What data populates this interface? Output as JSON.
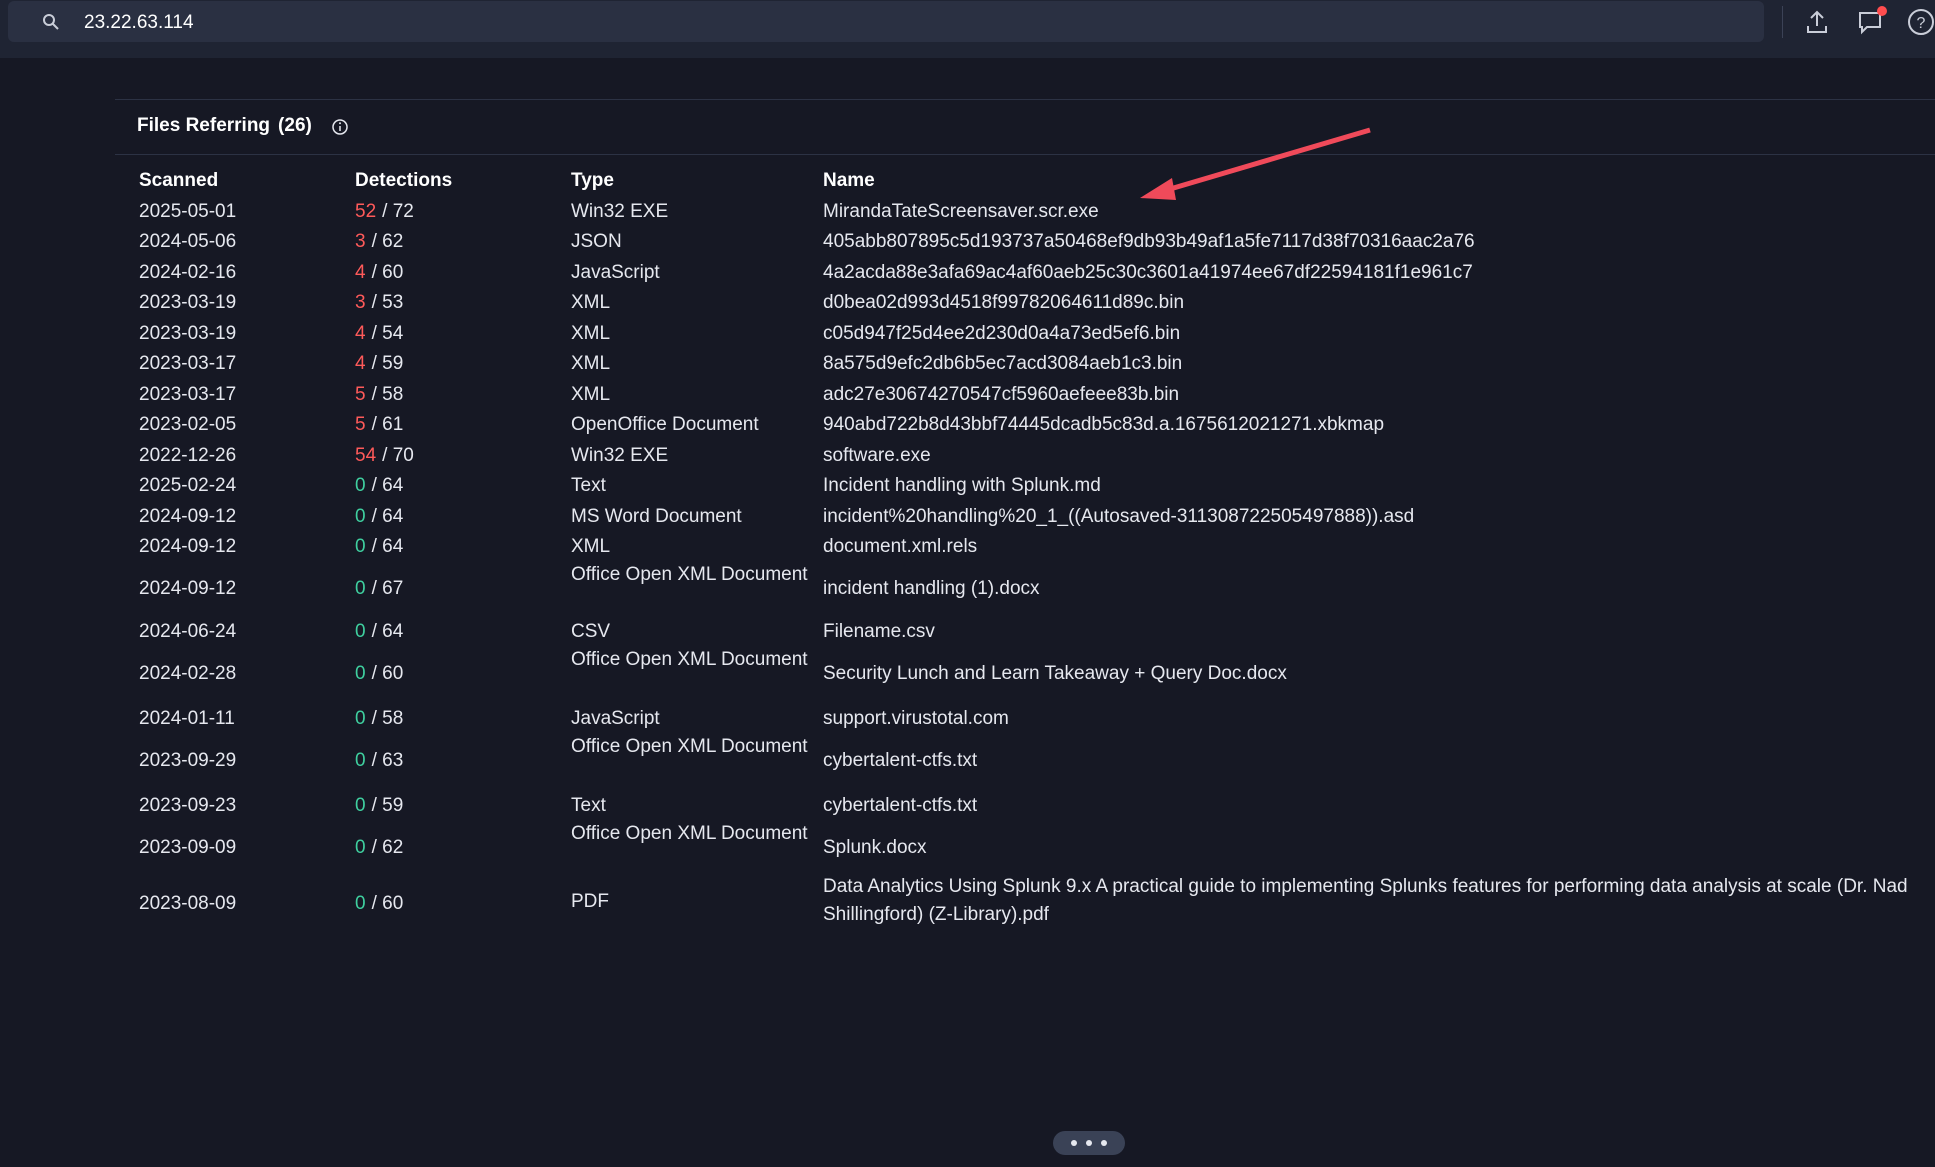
{
  "search": {
    "value": "23.22.63.114"
  },
  "toolbar": {
    "upload_icon": "upload-icon",
    "chat_icon": "chat-icon",
    "help_icon": "help-icon",
    "notification_color": "#ff4d4f"
  },
  "section": {
    "title": "Files Referring",
    "count": "(26)"
  },
  "table": {
    "headers": {
      "scanned": "Scanned",
      "detections": "Detections",
      "type": "Type",
      "name": "Name"
    },
    "rows": [
      {
        "scanned": "2025-05-01",
        "det": "52",
        "total": "/ 72",
        "type": "Win32 EXE",
        "name": "MirandaTateScreensaver.scr.exe"
      },
      {
        "scanned": "2024-05-06",
        "det": "3",
        "total": "/ 62",
        "type": "JSON",
        "name": "405abb807895c5d193737a50468ef9db93b49af1a5fe7117d38f70316aac2a76"
      },
      {
        "scanned": "2024-02-16",
        "det": "4",
        "total": "/ 60",
        "type": "JavaScript",
        "name": "4a2acda88e3afa69ac4af60aeb25c30c3601a41974ee67df22594181f1e961c7"
      },
      {
        "scanned": "2023-03-19",
        "det": "3",
        "total": "/ 53",
        "type": "XML",
        "name": "d0bea02d993d4518f99782064611d89c.bin"
      },
      {
        "scanned": "2023-03-19",
        "det": "4",
        "total": "/ 54",
        "type": "XML",
        "name": "c05d947f25d4ee2d230d0a4a73ed5ef6.bin"
      },
      {
        "scanned": "2023-03-17",
        "det": "4",
        "total": "/ 59",
        "type": "XML",
        "name": "8a575d9efc2db6b5ec7acd3084aeb1c3.bin"
      },
      {
        "scanned": "2023-03-17",
        "det": "5",
        "total": "/ 58",
        "type": "XML",
        "name": "adc27e30674270547cf5960aefeee83b.bin"
      },
      {
        "scanned": "2023-02-05",
        "det": "5",
        "total": "/ 61",
        "type": "OpenOffice Document",
        "name": "940abd722b8d43bbf74445dcadb5c83d.a.1675612021271.xbkmap"
      },
      {
        "scanned": "2022-12-26",
        "det": "54",
        "total": "/ 70",
        "type": "Win32 EXE",
        "name": "software.exe"
      },
      {
        "scanned": "2025-02-24",
        "det": "0",
        "total": "/ 64",
        "type": "Text",
        "name": "Incident handling with Splunk.md"
      },
      {
        "scanned": "2024-09-12",
        "det": "0",
        "total": "/ 64",
        "type": "MS Word Document",
        "name": "incident%20handling%20_1_((Autosaved-311308722505497888)).asd"
      },
      {
        "scanned": "2024-09-12",
        "det": "0",
        "total": "/ 64",
        "type": "XML",
        "name": "document.xml.rels"
      },
      {
        "scanned": "2024-09-12",
        "det": "0",
        "total": "/ 67",
        "type": "Office Open XML Document",
        "name": "incident handling (1).docx"
      },
      {
        "scanned": "2024-06-24",
        "det": "0",
        "total": "/ 64",
        "type": "CSV",
        "name": "Filename.csv"
      },
      {
        "scanned": "2024-02-28",
        "det": "0",
        "total": "/ 60",
        "type": "Office Open XML Document",
        "name": "Security Lunch and Learn Takeaway + Query Doc.docx"
      },
      {
        "scanned": "2024-01-11",
        "det": "0",
        "total": "/ 58",
        "type": "JavaScript",
        "name": "support.virustotal.com"
      },
      {
        "scanned": "2023-09-29",
        "det": "0",
        "total": "/ 63",
        "type": "Office Open XML Document",
        "name": "cybertalent-ctfs.txt"
      },
      {
        "scanned": "2023-09-23",
        "det": "0",
        "total": "/ 59",
        "type": "Text",
        "name": "cybertalent-ctfs.txt"
      },
      {
        "scanned": "2023-09-09",
        "det": "0",
        "total": "/ 62",
        "type": "Office Open XML Document",
        "name": "Splunk.docx"
      },
      {
        "scanned": "2023-08-09",
        "det": "0",
        "total": "/ 60",
        "type": "PDF",
        "name": "Data Analytics Using Splunk 9.x A practical guide to implementing Splunks features for performing data analysis at scale (Dr. Nad Shillingford) (Z-Library).pdf"
      }
    ]
  },
  "colors": {
    "positive": "#ff5a5a",
    "zero": "#3fcf9f",
    "annotation_arrow": "#f04a5a"
  }
}
